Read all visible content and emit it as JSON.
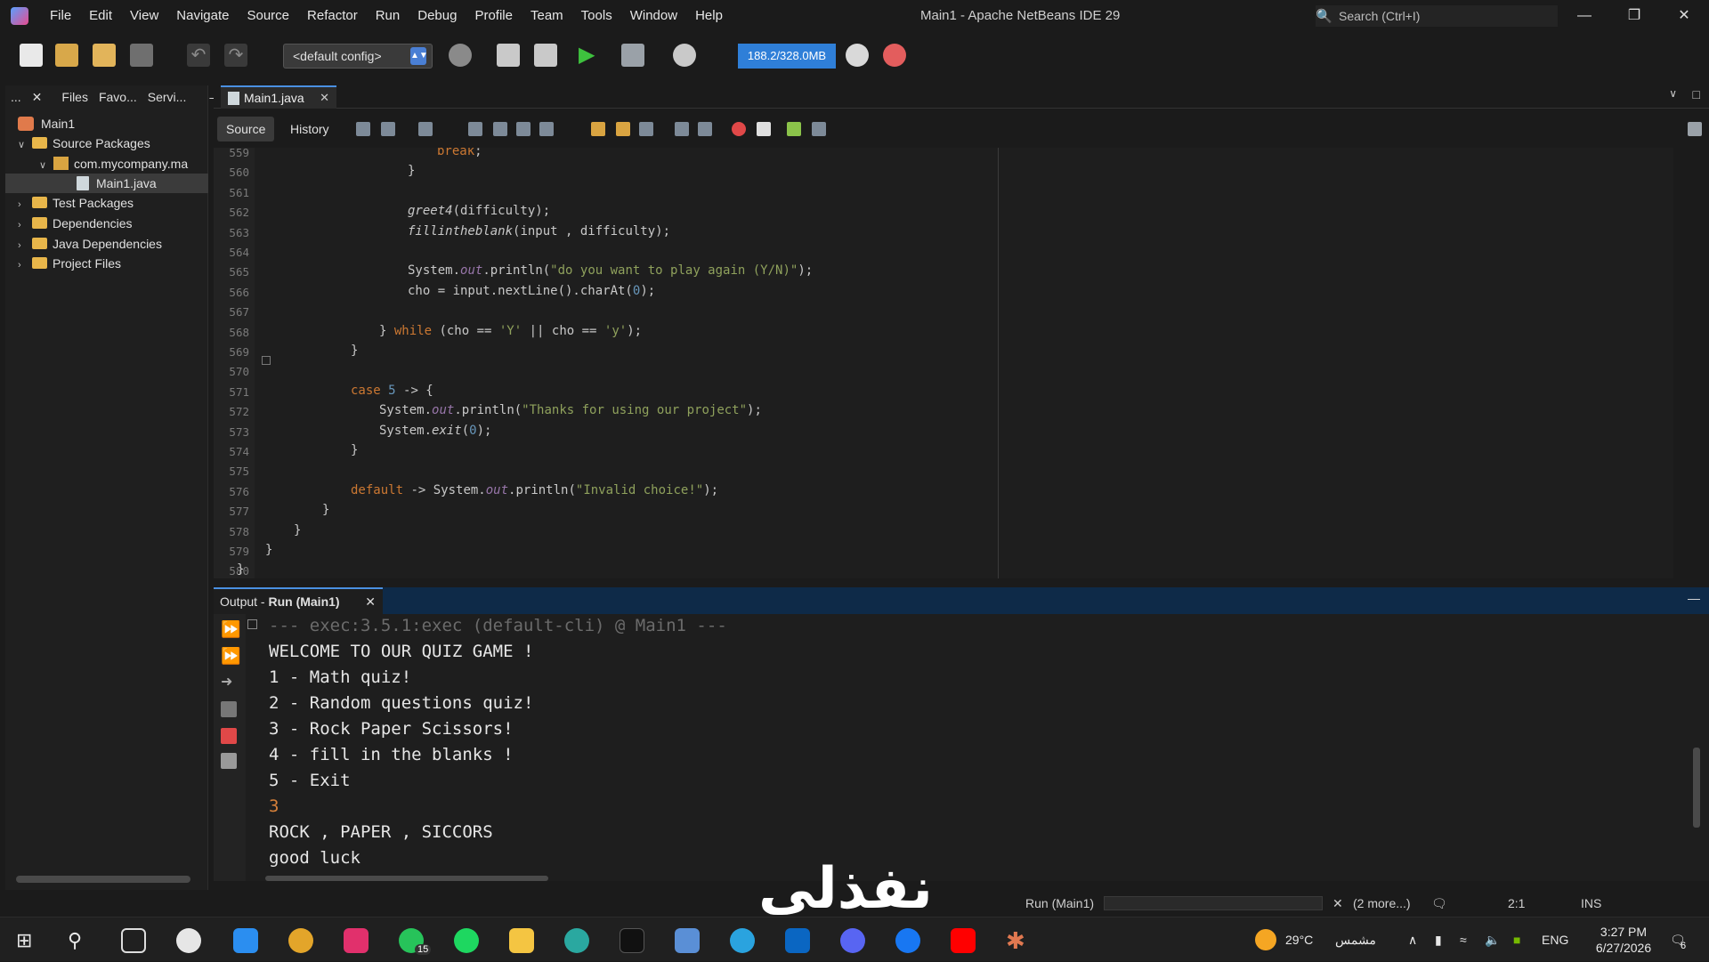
{
  "window": {
    "title": "Main1 - Apache NetBeans IDE 29",
    "menu": [
      "File",
      "Edit",
      "View",
      "Navigate",
      "Source",
      "Refactor",
      "Run",
      "Debug",
      "Profile",
      "Team",
      "Tools",
      "Window",
      "Help"
    ],
    "search_placeholder": "Search (Ctrl+I)"
  },
  "toolbar": {
    "config": "<default config>",
    "memory": "188.2/328.0MB"
  },
  "project_panel": {
    "tabs": [
      "...",
      "Files",
      "Favo...",
      "Servi..."
    ],
    "tree": [
      {
        "label": "Main1",
        "type": "project"
      },
      {
        "label": "Source Packages",
        "type": "folder"
      },
      {
        "label": "com.mycompany.ma",
        "type": "package"
      },
      {
        "label": "Main1.java",
        "type": "file"
      },
      {
        "label": "Test Packages",
        "type": "folder"
      },
      {
        "label": "Dependencies",
        "type": "folder"
      },
      {
        "label": "Java Dependencies",
        "type": "folder"
      },
      {
        "label": "Project Files",
        "type": "folder"
      }
    ]
  },
  "editor": {
    "tab": "Main1.java",
    "modes": [
      "Source",
      "History"
    ],
    "line_numbers": [
      "559",
      "560",
      "561",
      "562",
      "563",
      "564",
      "565",
      "566",
      "567",
      "568",
      "569",
      "570",
      "571",
      "572",
      "573",
      "574",
      "575",
      "576",
      "577",
      "578",
      "579",
      "580"
    ],
    "code": [
      {
        "indent": 0,
        "parts": [
          [
            "kw",
            "break"
          ],
          [
            "p",
            ";"
          ]
        ]
      },
      {
        "indent": 0,
        "parts": [
          [
            "p",
            "}"
          ]
        ]
      },
      {
        "indent": 0,
        "parts": []
      },
      {
        "indent": 0,
        "parts": [
          [
            "it",
            "greet4"
          ],
          [
            "p",
            "(difficulty);"
          ]
        ]
      },
      {
        "indent": 0,
        "parts": [
          [
            "it",
            "fillintheblank"
          ],
          [
            "p",
            "(input , difficulty);"
          ]
        ]
      },
      {
        "indent": 0,
        "parts": []
      },
      {
        "indent": 0,
        "parts": [
          [
            "p",
            "System."
          ],
          [
            "fld",
            "out"
          ],
          [
            "p",
            ".println("
          ],
          [
            "str",
            "\"do you want to play again (Y/N)\""
          ],
          [
            "p",
            ");"
          ]
        ]
      },
      {
        "indent": 0,
        "parts": [
          [
            "p",
            "cho = input.nextLine().charAt("
          ],
          [
            "num",
            "0"
          ],
          [
            "p",
            ");"
          ]
        ]
      },
      {
        "indent": 0,
        "parts": []
      },
      {
        "indent": 0,
        "parts": [
          [
            "p",
            "} "
          ],
          [
            "kw",
            "while"
          ],
          [
            "p",
            " (cho == "
          ],
          [
            "str",
            "'Y'"
          ],
          [
            "p",
            " || cho == "
          ],
          [
            "str",
            "'y'"
          ],
          [
            "p",
            ");"
          ]
        ]
      },
      {
        "indent": 0,
        "parts": [
          [
            "p",
            "}"
          ]
        ]
      },
      {
        "indent": 0,
        "parts": []
      },
      {
        "indent": 0,
        "parts": [
          [
            "kw",
            "case"
          ],
          [
            "p",
            " "
          ],
          [
            "num",
            "5"
          ],
          [
            "p",
            " -> {"
          ]
        ]
      },
      {
        "indent": 0,
        "parts": [
          [
            "p",
            "System."
          ],
          [
            "fld",
            "out"
          ],
          [
            "p",
            ".println("
          ],
          [
            "str",
            "\"Thanks for using our project\""
          ],
          [
            "p",
            ");"
          ]
        ]
      },
      {
        "indent": 0,
        "parts": [
          [
            "p",
            "System."
          ],
          [
            "it",
            "exit"
          ],
          [
            "p",
            "("
          ],
          [
            "num",
            "0"
          ],
          [
            "p",
            ");"
          ]
        ]
      },
      {
        "indent": 0,
        "parts": [
          [
            "p",
            "}"
          ]
        ]
      },
      {
        "indent": 0,
        "parts": []
      },
      {
        "indent": 0,
        "parts": [
          [
            "kw",
            "default"
          ],
          [
            "p",
            " -> System."
          ],
          [
            "fld",
            "out"
          ],
          [
            "p",
            ".println("
          ],
          [
            "str",
            "\"Invalid choice!\""
          ],
          [
            "p",
            ");"
          ]
        ]
      },
      {
        "indent": 0,
        "parts": [
          [
            "p",
            "}"
          ]
        ]
      },
      {
        "indent": 0,
        "parts": [
          [
            "p",
            "}"
          ]
        ]
      },
      {
        "indent": 0,
        "parts": [
          [
            "p",
            "}"
          ]
        ]
      },
      {
        "indent": 0,
        "parts": [
          [
            "p",
            "}"
          ]
        ]
      }
    ]
  },
  "output": {
    "tab_prefix": "Output - ",
    "tab_name": "Run (Main1)",
    "lines": [
      "--- exec:3.5.1:exec (default-cli) @ Main1 ---",
      "WELCOME TO OUR QUIZ GAME !",
      "1 - Math quiz!",
      "2 - Random questions quiz!",
      "3 - Rock Paper Scissors!",
      "4 - fill in the blanks !",
      "5 - Exit",
      "3",
      "ROCK , PAPER , SICCORS",
      "good luck"
    ]
  },
  "statusbar": {
    "task": "Run (Main1)",
    "more": "(2 more...)",
    "position": "2:1",
    "mode": "INS"
  },
  "watermark": "نفذلي",
  "taskbar": {
    "weather_temp": "29°C",
    "weather_text": "مشمس",
    "lang": "ENG",
    "time": "3:27 PM",
    "date": "6/27/2026",
    "notif_count": "6",
    "whatsapp_badge": "15"
  }
}
